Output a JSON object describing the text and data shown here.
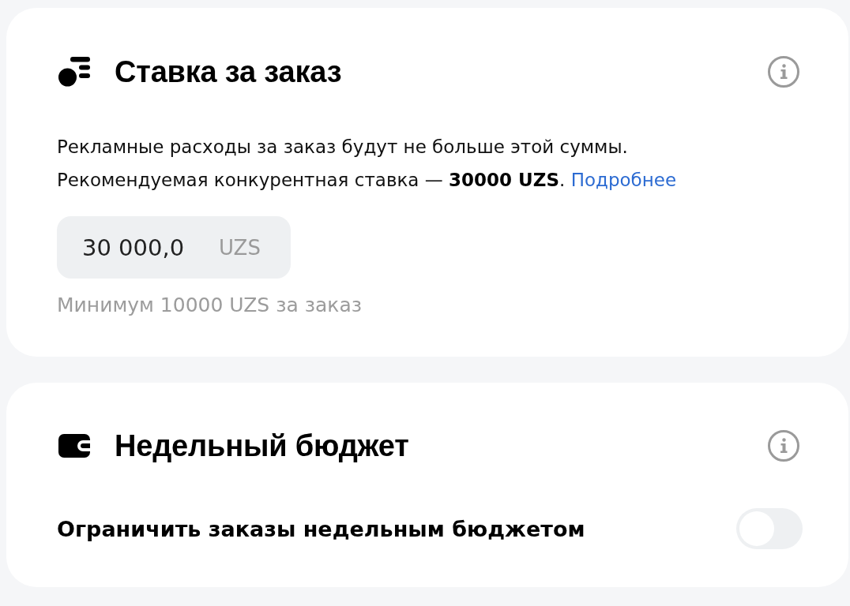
{
  "sections": [
    {
      "kind": "bid",
      "title": "Ставка за заказ",
      "description": [
        "Рекламные расходы за заказ будут не больше этой суммы.",
        "Рекомендуемая конкурентная ставка — **30000 UZS**."
      ],
      "link": "Подробнее",
      "input": {
        "value": "30 000,0",
        "unit": "UZS"
      },
      "hint": "Минимум 10000 UZS за заказ"
    },
    {
      "kind": "budget",
      "title": "Недельный бюджет",
      "toggle": {
        "label": "Ограничить заказы недельным бюджетом",
        "on": false
      }
    }
  ]
}
